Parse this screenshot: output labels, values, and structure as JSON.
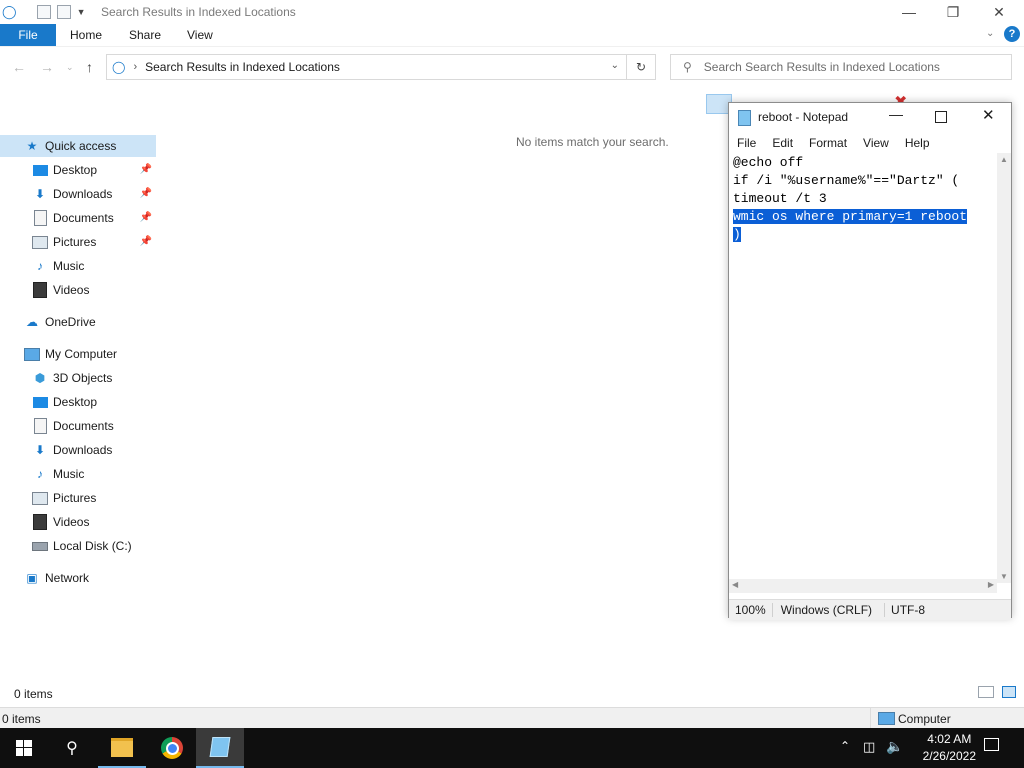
{
  "explorer": {
    "title": "Search Results in Indexed Locations",
    "ribbon": {
      "file": "File",
      "tabs": [
        "Home",
        "Share",
        "View"
      ]
    },
    "address": {
      "text": "Search Results in Indexed Locations"
    },
    "search": {
      "placeholder": "Search Search Results in Indexed Locations"
    },
    "empty_message": "No items match your search.",
    "status_items": "0 items",
    "bottom_status": "0 items",
    "bottom_location": "Computer"
  },
  "navpane": {
    "quick_access": "Quick access",
    "quick_items": [
      "Desktop",
      "Downloads",
      "Documents",
      "Pictures",
      "Music",
      "Videos"
    ],
    "onedrive": "OneDrive",
    "my_computer": "My Computer",
    "pc_items": [
      "3D Objects",
      "Desktop",
      "Documents",
      "Downloads",
      "Music",
      "Pictures",
      "Videos",
      "Local Disk (C:)"
    ],
    "network": "Network"
  },
  "notepad": {
    "title": "reboot - Notepad",
    "menu": [
      "File",
      "Edit",
      "Format",
      "View",
      "Help"
    ],
    "lines": [
      "@echo off",
      "if /i \"%username%\"==\"Dartz\" (",
      "timeout /t 3"
    ],
    "selected_lines": [
      "wmic os where primary=1 reboot",
      ")"
    ],
    "status": {
      "zoom": "100%",
      "line_endings": "Windows (CRLF)",
      "encoding": "UTF-8"
    }
  },
  "taskbar": {
    "time": "4:02 AM",
    "date": "2/26/2022"
  },
  "colors": {
    "accent": "#1979ca",
    "selection": "#0b5fd6",
    "nav_highlight": "#cce4f7"
  }
}
